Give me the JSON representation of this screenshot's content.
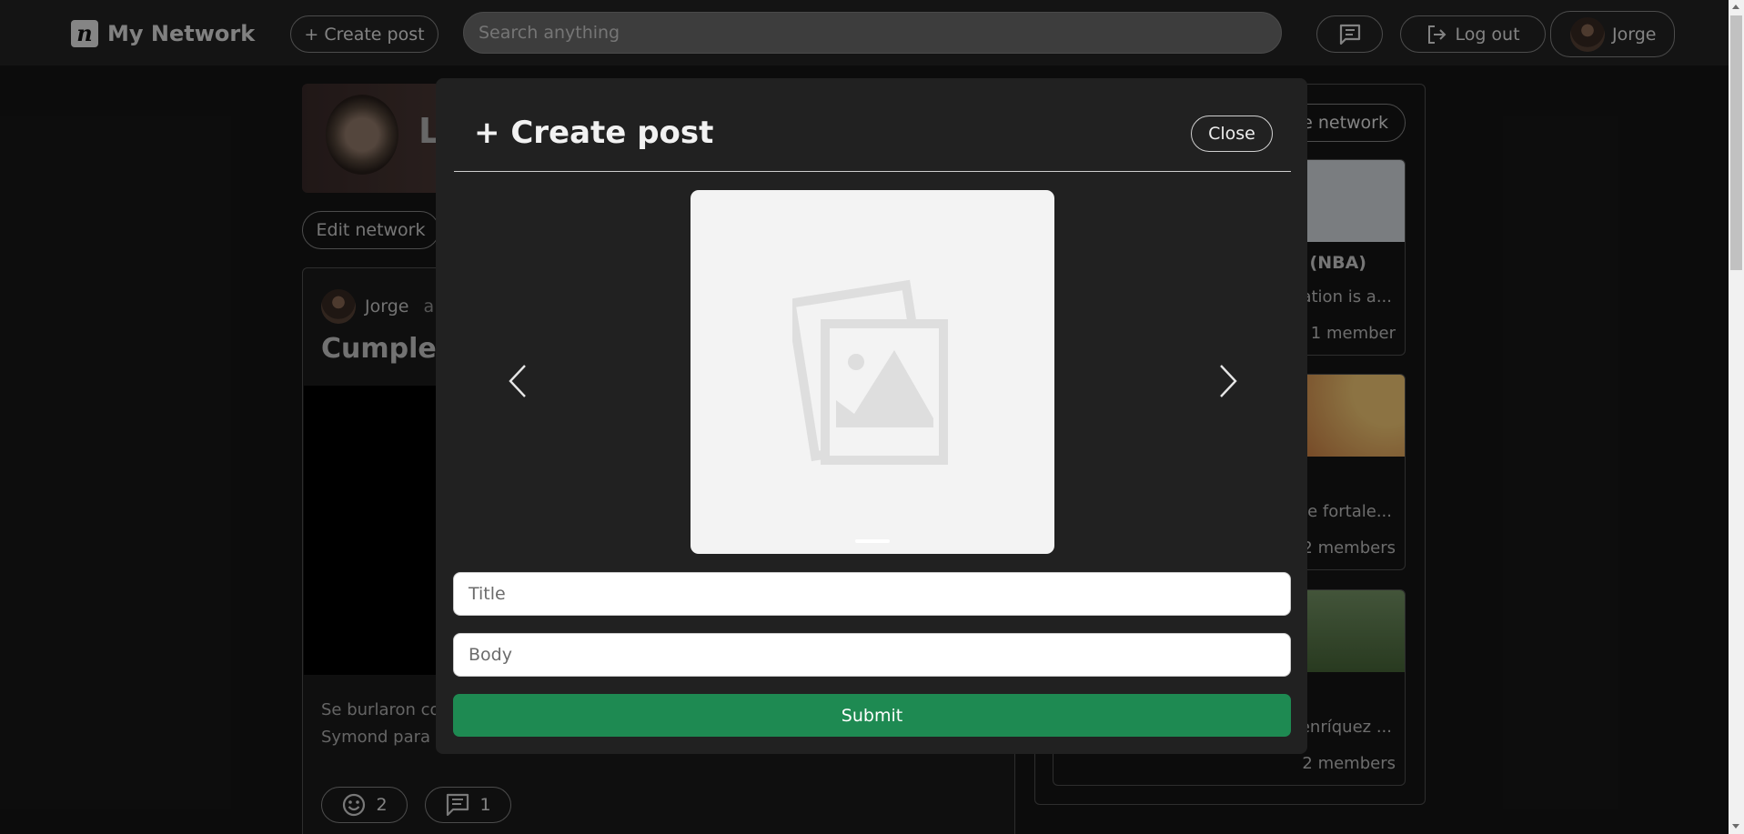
{
  "nav": {
    "brand_logo_glyph": "n",
    "brand_name": "My Network",
    "create_post_label": "+ Create post",
    "search_placeholder": "Search anything",
    "logout_label": "Log out",
    "user_name": "Jorge"
  },
  "background": {
    "banner_initial": "Lo",
    "edit_network_label": "Edit network",
    "post": {
      "author": "Jorge",
      "author_suffix": "a",
      "title": "Cumplea",
      "body_line1": "Se burlaron co",
      "body_line2": "Symond para v",
      "reactions_count": "2",
      "comments_count": "1"
    },
    "sidebar": {
      "button_label": "e network",
      "networks": [
        {
          "title": "n (NBA)",
          "desc": "ation is a...",
          "members": "1 member",
          "color": "#b9c2d4"
        },
        {
          "title": "",
          "desc": "e fortale...",
          "members": "2 members",
          "color": "#c2703a"
        },
        {
          "title": "",
          "desc": "enríquez ...",
          "members": "2 members",
          "color": "#5a7a4a"
        }
      ]
    }
  },
  "modal": {
    "title": "+ Create post",
    "close_label": "Close",
    "title_placeholder": "Title",
    "body_placeholder": "Body",
    "submit_label": "Submit"
  }
}
